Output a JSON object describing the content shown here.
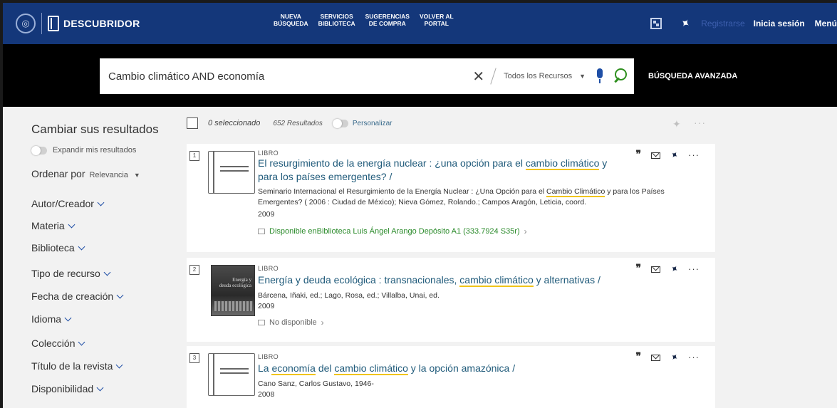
{
  "brand": {
    "name": "DESCUBRIDOR"
  },
  "topnav": [
    {
      "label": "NUEVA\nBÚSQUEDA"
    },
    {
      "label": "SERVICIOS\nBIBLIOTECA"
    },
    {
      "label": "SUGERENCIAS\nDE COMPRA"
    },
    {
      "label": "VOLVER AL\nPORTAL"
    }
  ],
  "account": {
    "register": "Registrarse",
    "login": "Inicia sesión",
    "menu": "Menú"
  },
  "search": {
    "query": "Cambio climático AND economía",
    "scope": "Todos los Recursos",
    "advanced": "BÚSQUEDA AVANZADA"
  },
  "sidebar": {
    "title": "Cambiar sus resultados",
    "expand": "Expandir mis resultados",
    "sort_label": "Ordenar por",
    "sort_value": "Relevancia",
    "facets": [
      "Autor/Creador",
      "Materia",
      "Biblioteca",
      "Tipo de recurso",
      "Fecha de creación",
      "Idioma",
      "Colección",
      "Título de la revista",
      "Disponibilidad"
    ]
  },
  "results_header": {
    "selected": "0 seleccionado",
    "count": "652 Resultados",
    "personalize": "Personalizar"
  },
  "results": [
    {
      "num": "1",
      "type": "LIBRO",
      "title_parts": [
        "El resurgimiento de la energía nuclear : ¿una opción para el ",
        "cambio climático",
        " y para los países emergentes? /"
      ],
      "meta_parts": [
        "Seminario Internacional el Resurgimiento de la Energía Nuclear : ¿Una Opción para el ",
        "Cambio Climático",
        " y para los Países Emergentes? ( 2006 : Ciudad de México); Nieva Gómez, Rolando.; Campos Aragón, Leticia, coord."
      ],
      "year": "2009",
      "avail_status": "Disponible en",
      "avail_location": " Biblioteca Luis Ángel Arango  Depósito A1 (333.7924 S35r)"
    },
    {
      "num": "2",
      "type": "LIBRO",
      "cover_text": "Energía y\ndeuda ecológica",
      "title_parts": [
        "Energía y deuda ecológica : transnacionales, ",
        "cambio climático",
        " y alternativas /"
      ],
      "meta": "Bárcena, Iñaki, ed.; Lago, Rosa, ed.; Villalba, Unai, ed.",
      "year": "2009",
      "avail_status": "No disponible"
    },
    {
      "num": "3",
      "type": "LIBRO",
      "title_parts": [
        "La ",
        "economía",
        " del ",
        "cambio climático",
        " y la opción amazónica /"
      ],
      "meta": "Cano Sanz, Carlos Gustavo, 1946-",
      "year": "2008"
    }
  ],
  "colors": {
    "topbar": "#14377a",
    "search_band": "#000000",
    "title_link": "#1f5a7a",
    "highlight": "#f0c419",
    "available": "#2a8a2a"
  }
}
